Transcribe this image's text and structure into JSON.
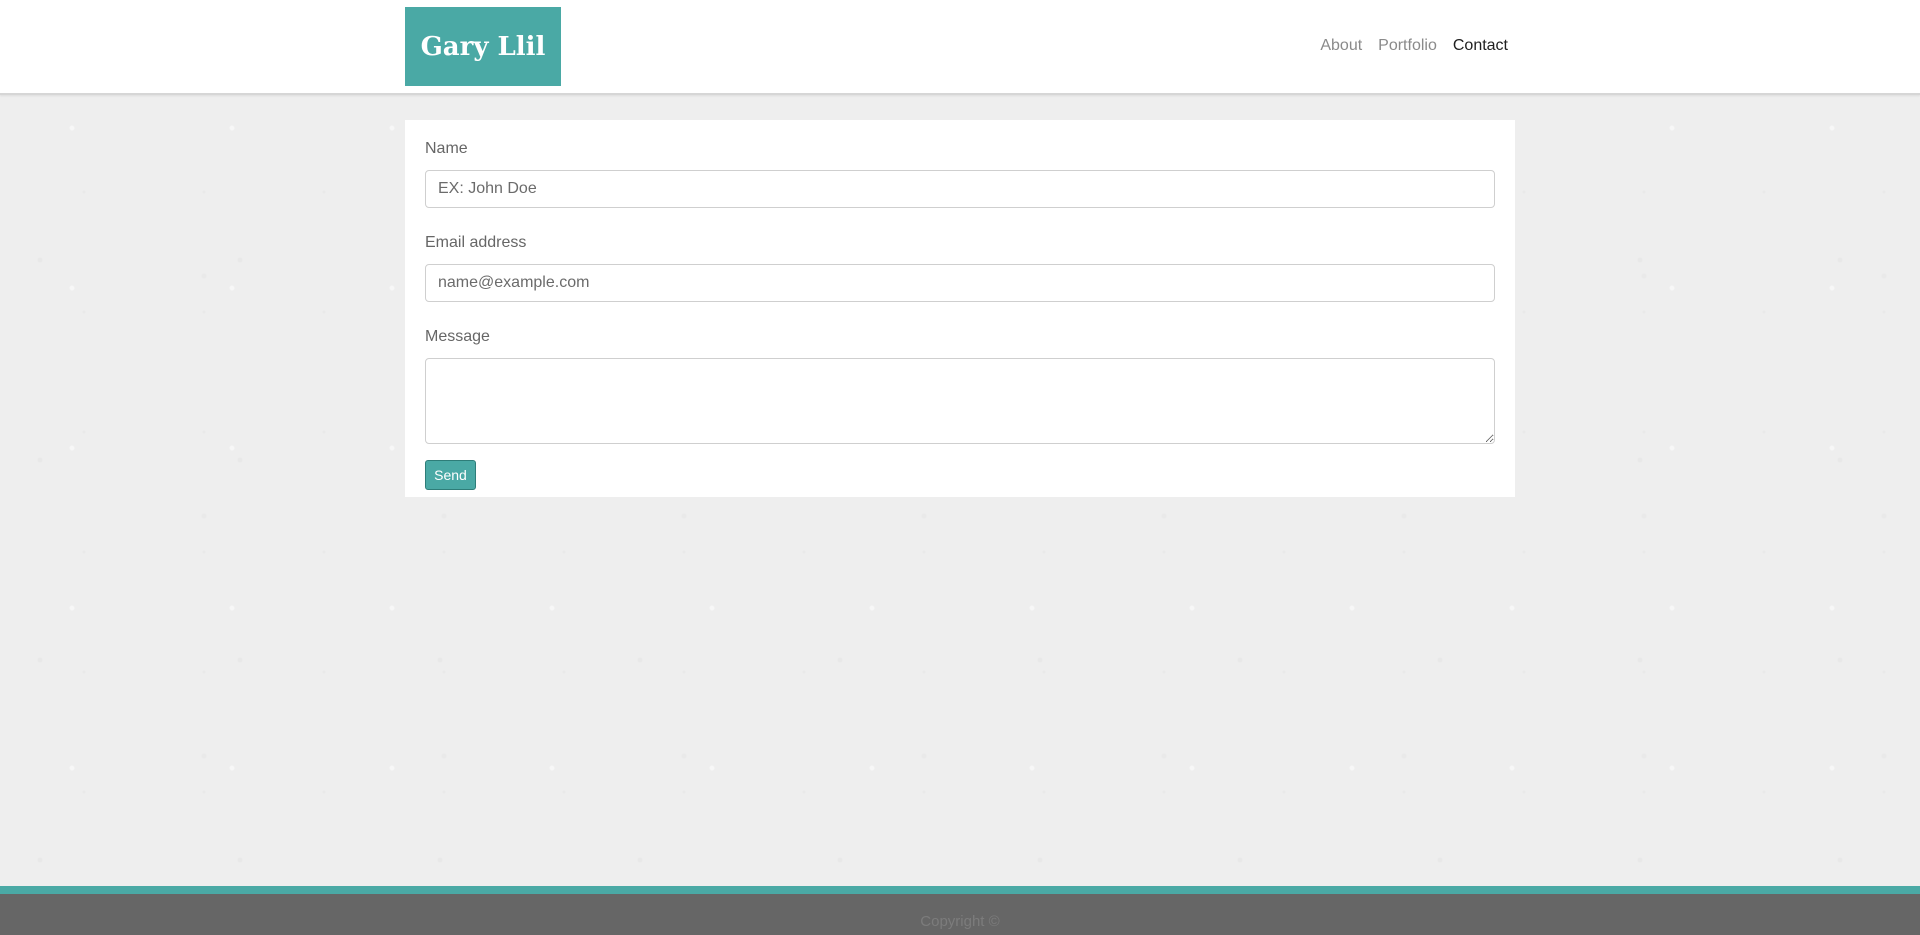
{
  "brand": {
    "name": "Gary Llil"
  },
  "nav": {
    "items": [
      {
        "label": "About"
      },
      {
        "label": "Portfolio"
      },
      {
        "label": "Contact"
      }
    ],
    "active": "Contact"
  },
  "form": {
    "name_label": "Name",
    "name_placeholder": "EX: John Doe",
    "email_label": "Email address",
    "email_placeholder": "name@example.com",
    "message_label": "Message",
    "send_label": "Send"
  },
  "footer": {
    "copyright": "Copyright ©"
  },
  "colors": {
    "accent": "#4aa9a5",
    "footer_bg": "#666666",
    "page_bg": "#eeeeee"
  }
}
